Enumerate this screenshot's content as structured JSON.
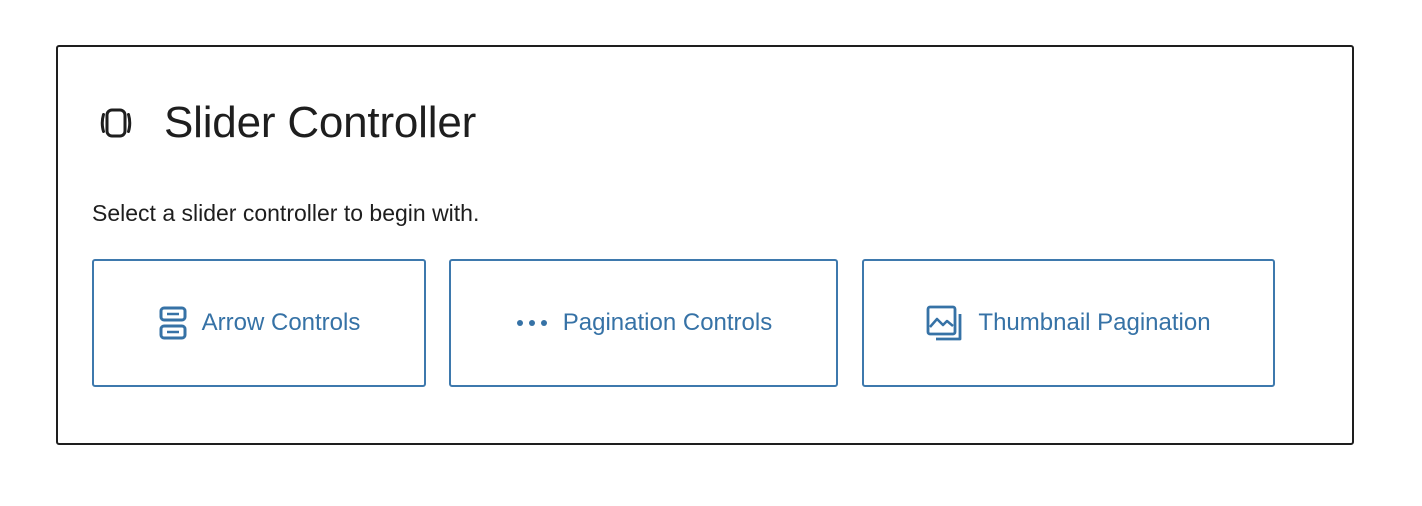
{
  "placeholder": {
    "title": "Slider Controller",
    "instructions": "Select a slider controller to begin with.",
    "icon": "slider-icon"
  },
  "options": [
    {
      "label": "Arrow Controls",
      "icon": "arrow-controls-icon"
    },
    {
      "label": "Pagination Controls",
      "icon": "ellipsis-dots-icon"
    },
    {
      "label": "Thumbnail Pagination",
      "icon": "image-gallery-icon"
    }
  ],
  "colors": {
    "accent": "#3672a6",
    "text": "#1e1e1e",
    "border": "#1e1e1e"
  }
}
